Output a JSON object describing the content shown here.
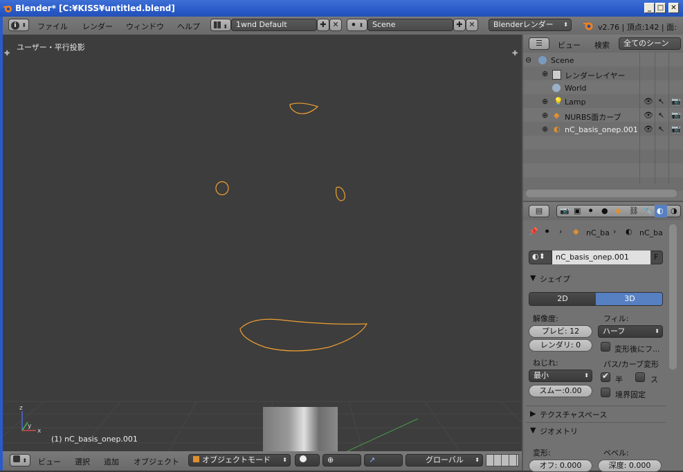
{
  "window": {
    "title": "Blender* [C:¥KISS¥untitled.blend]",
    "min": "_",
    "max": "□",
    "close": "✕"
  },
  "topbar": {
    "info_icon": "i",
    "menus": [
      "ファイル",
      "レンダー",
      "ウィンドウ",
      "ヘルプ"
    ],
    "layout_value": "1wnd Default",
    "scene_value": "Scene",
    "engine_value": "Blenderレンダー",
    "stats": "v2.76 | 頂点:142 | 面:"
  },
  "viewport": {
    "label": "ユーザー・平行投影",
    "object_label": "(1) nC_basis_onep.001",
    "curve_color": "#f0a030",
    "axis_x": "x",
    "axis_y": "y",
    "axis_z": "z"
  },
  "bottombar": {
    "menus": [
      "ビュー",
      "選択",
      "追加",
      "オブジェクト"
    ],
    "mode": "オブジェクトモード",
    "orientation": "グローバル"
  },
  "outliner": {
    "header_menus": [
      "ビュー",
      "検索"
    ],
    "scope": "全てのシーン",
    "items": [
      {
        "label": "Scene",
        "indent": 0
      },
      {
        "label": "レンダーレイヤー",
        "indent": 1
      },
      {
        "label": "World",
        "indent": 1
      },
      {
        "label": "Lamp",
        "indent": 1
      },
      {
        "label": "NURBS面カーブ",
        "indent": 1
      },
      {
        "label": "nC_basis_onep.001",
        "indent": 1
      }
    ]
  },
  "properties": {
    "breadcrumb": [
      "nC_ba",
      "nC_ba"
    ],
    "datablock": "nC_basis_onep.001",
    "fake_user": "F",
    "shape_panel": "シェイプ",
    "tab_2d": "2D",
    "tab_3d": "3D",
    "resolution_label": "解像度:",
    "preview": "プレビ:  12",
    "render": "レンダリ:  0",
    "fill_label": "フィル:",
    "fill_value": "ハーフ",
    "fill_deform": "変形後にフ...",
    "twist_label": "ねじれ:",
    "twist_value": "最小",
    "smooth": "スムー:0.00",
    "path_label": "パス/カーブ変形",
    "radius_chk": "半",
    "stretch_chk": "ス",
    "bounds_clamp": "境界固定",
    "texspace_panel": "テクスチャスペース",
    "geometry_panel": "ジオメトリ",
    "deform_label": "変形:",
    "bevel_label": "ベベル:",
    "offset": "オフ: 0.000",
    "depth": "深度:  0.000",
    "accent": "#5680c2"
  }
}
